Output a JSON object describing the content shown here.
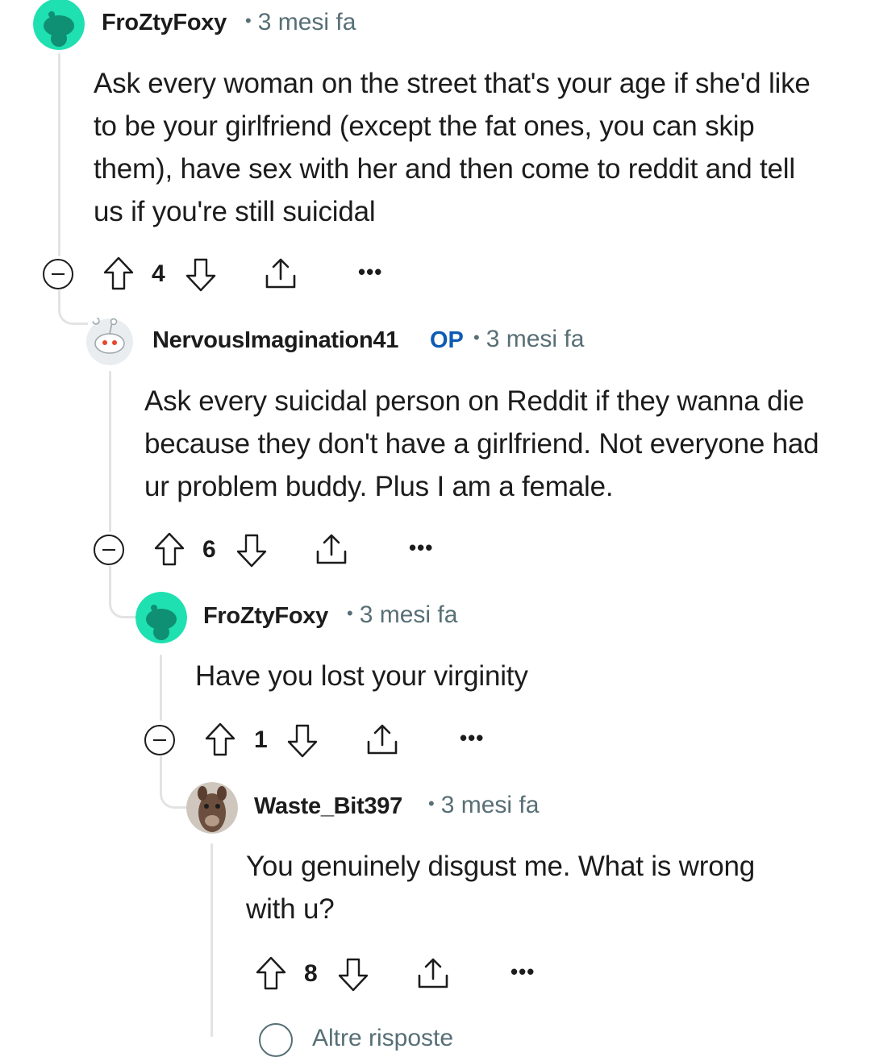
{
  "comments": [
    {
      "username": "FroZtyFoxy",
      "time": "3 mesi fa",
      "text": "Ask every woman on the street that's your age if she'd like to be your girlfriend (except the fat ones, you can skip them), have sex with her and then come to reddit and tell us if you're still suicidal",
      "score": "4",
      "avatar_color": "#1ee0b0"
    },
    {
      "username": "NervousImagination41",
      "badge": "OP",
      "time": "3 mesi fa",
      "text": "Ask every suicidal person on Reddit if they wanna die because they don't have a girlfriend. Not everyone had ur problem buddy. Plus I am a female.",
      "score": "6",
      "avatar_color": "#e9edf0"
    },
    {
      "username": "FroZtyFoxy",
      "time": "3 mesi fa",
      "text": "Have you lost your virginity",
      "score": "1",
      "avatar_color": "#1ee0b0"
    },
    {
      "username": "Waste_Bit397",
      "time": "3 mesi fa",
      "text": "You genuinely disgust me. What is wrong with u?",
      "score": "8",
      "avatar_color": "#6b4e3d"
    }
  ],
  "more_replies_label": "Altre risposte",
  "icons": {
    "upvote": "upvote-arrow-icon",
    "downvote": "downvote-arrow-icon",
    "share": "share-icon",
    "more": "more-options-icon",
    "collapse": "collapse-thread-icon"
  },
  "colors": {
    "accent_op": "#0f5bb3",
    "meta": "#576f76",
    "thread_line": "#e3e3e3"
  }
}
